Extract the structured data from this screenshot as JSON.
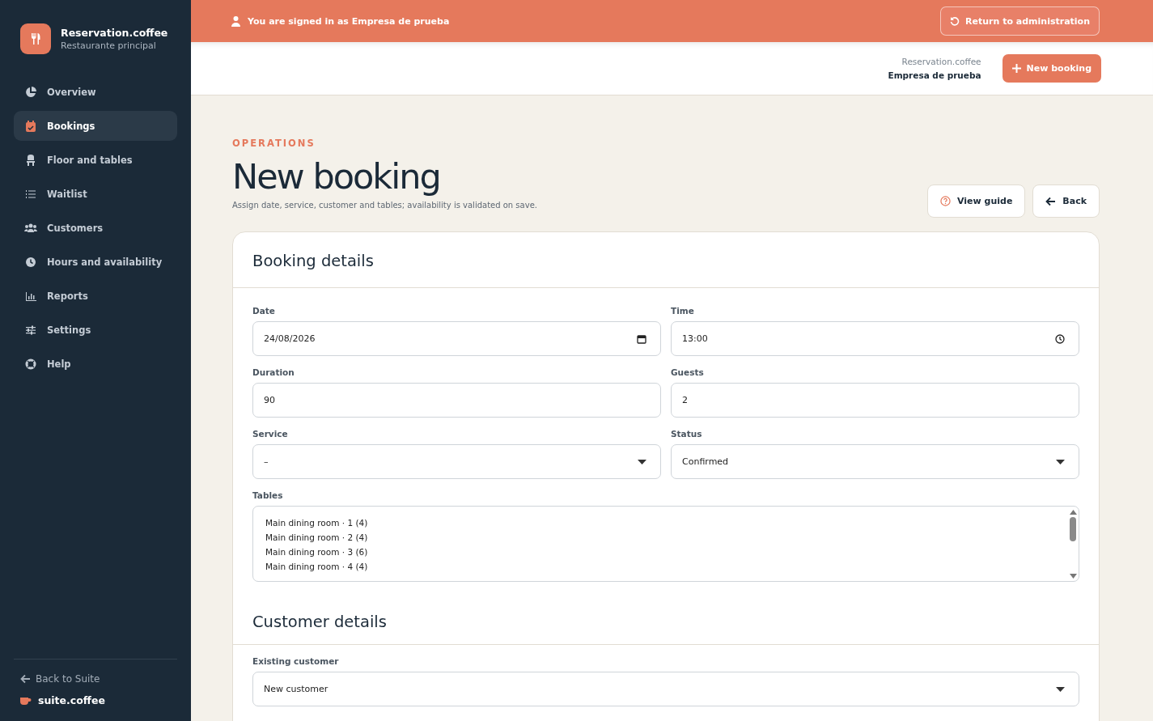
{
  "brand": {
    "name": "Reservation.coffee",
    "subtitle": "Restaurante principal"
  },
  "nav": [
    {
      "label": "Overview",
      "kind": "pie",
      "selected": false
    },
    {
      "label": "Bookings",
      "kind": "calendar",
      "selected": true
    },
    {
      "label": "Floor and tables",
      "kind": "chair",
      "selected": false
    },
    {
      "label": "Waitlist",
      "kind": "list",
      "selected": false
    },
    {
      "label": "Customers",
      "kind": "people",
      "selected": false
    },
    {
      "label": "Hours and availability",
      "kind": "clock",
      "selected": false
    },
    {
      "label": "Reports",
      "kind": "chart",
      "selected": false
    },
    {
      "label": "Settings",
      "kind": "sliders",
      "selected": false
    },
    {
      "label": "Help",
      "kind": "lifebuoy",
      "selected": false
    }
  ],
  "footer": {
    "back": "Back to Suite",
    "suite": "suite.coffee"
  },
  "banner": {
    "message": "You are signed in as Empresa de prueba",
    "button": "Return to administration"
  },
  "header": {
    "app": "Reservation.coffee",
    "company": "Empresa de prueba",
    "button": "New booking"
  },
  "page": {
    "eyebrow": "OPERATIONS",
    "title": "New booking",
    "subtitle": "Assign date, service, customer and tables; availability is validated on save.",
    "actions": [
      {
        "label": "View guide",
        "kind": "help"
      },
      {
        "label": "Back",
        "kind": "back"
      }
    ]
  },
  "sections": [
    {
      "title": "Booking details",
      "fields": [
        {
          "label": "Date",
          "kind": "date",
          "value": "24/08/2026"
        },
        {
          "label": "Time",
          "kind": "time",
          "value": "13:00"
        },
        {
          "label": "Duration",
          "kind": "text",
          "value": "90"
        },
        {
          "label": "Guests",
          "kind": "text",
          "value": "2"
        },
        {
          "label": "Service",
          "kind": "select",
          "value": "–"
        },
        {
          "label": "Status",
          "kind": "select",
          "value": "Confirmed"
        },
        {
          "label": "Tables",
          "kind": "multiselect",
          "options": [
            "Main dining room · 1 (4)",
            "Main dining room · 2 (4)",
            "Main dining room · 3 (6)",
            "Main dining room · 4 (4)"
          ]
        }
      ]
    },
    {
      "title": "Customer details",
      "fields": [
        {
          "label": "Existing customer",
          "kind": "select",
          "value": "New customer"
        }
      ]
    }
  ]
}
